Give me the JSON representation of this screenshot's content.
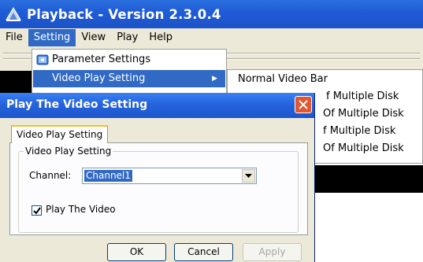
{
  "app": {
    "title": "Playback - Version 2.3.0.4",
    "menu": [
      "File",
      "Setting",
      "View",
      "Play",
      "Help"
    ]
  },
  "setting_menu": {
    "items": [
      {
        "label": "Parameter Settings"
      },
      {
        "label": "Video Play Setting"
      }
    ]
  },
  "video_submenu": {
    "items": [
      {
        "label": "Normal Video Bar"
      },
      {
        "label": "f Multiple Disk"
      },
      {
        "label": "Of Multiple Disk"
      },
      {
        "label": "f Multiple Disk"
      },
      {
        "label": "Of Multiple Disk"
      }
    ]
  },
  "dialog": {
    "title": "Play The Video Setting",
    "tab": "Video Play Setting",
    "group_label": "Video Play Setting",
    "channel_label": "Channel:",
    "channel_value": "Channel1",
    "checkbox_label": "Play The Video",
    "checkbox_checked": true,
    "ok": "OK",
    "cancel": "Cancel",
    "apply": "Apply"
  },
  "colors": {
    "titlebar": "#1f5cd6",
    "highlight": "#316ac5",
    "close": "#e2572f"
  }
}
